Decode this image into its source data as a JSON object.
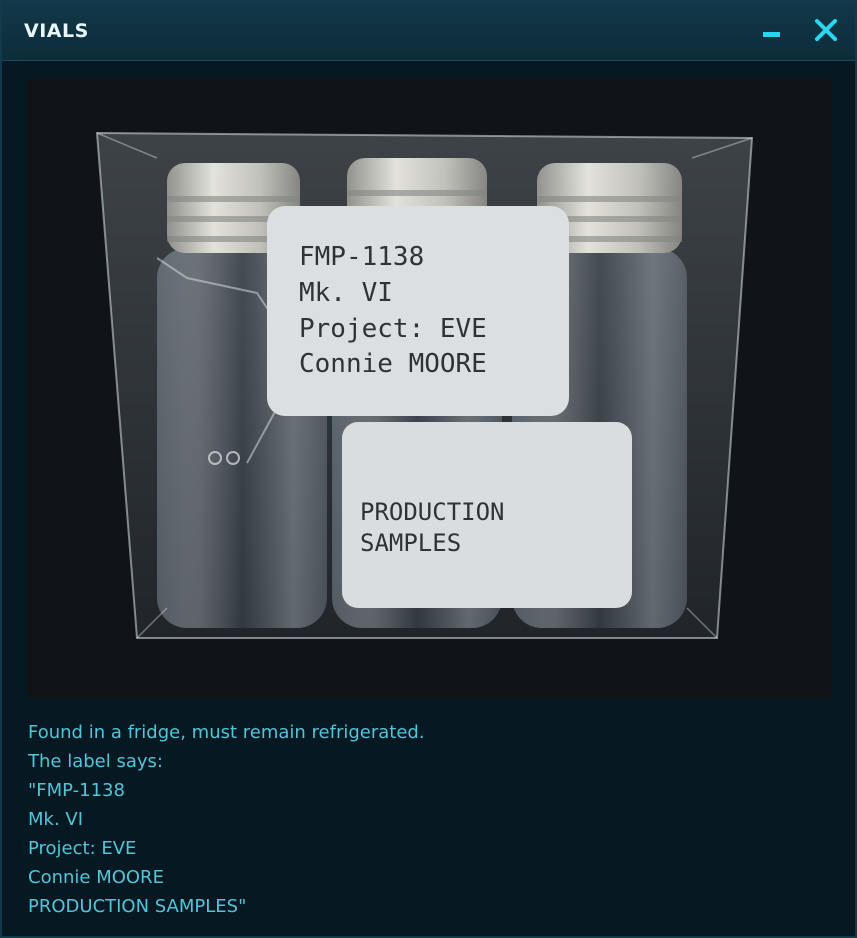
{
  "window": {
    "title": "VIALS",
    "minimize_icon": "minimize-icon",
    "close_icon": "close-icon",
    "close_label": "X",
    "accent_color": "#27d6f0",
    "text_color": "#50c6d8"
  },
  "photo": {
    "subject": "three glass vials in clear plastic box",
    "label_top": {
      "line1": "FMP-1138",
      "line2": "Mk. VI",
      "line3": "Project: EVE",
      "line4": "Connie MOORE"
    },
    "label_bottom": {
      "line1": "PRODUCTION",
      "line2": "SAMPLES"
    }
  },
  "description": {
    "lines": [
      "Found in a fridge, must remain refrigerated.",
      "The label says:",
      "\"FMP-1138",
      "Mk. VI",
      "Project: EVE",
      "Connie MOORE",
      "PRODUCTION SAMPLES\""
    ]
  }
}
